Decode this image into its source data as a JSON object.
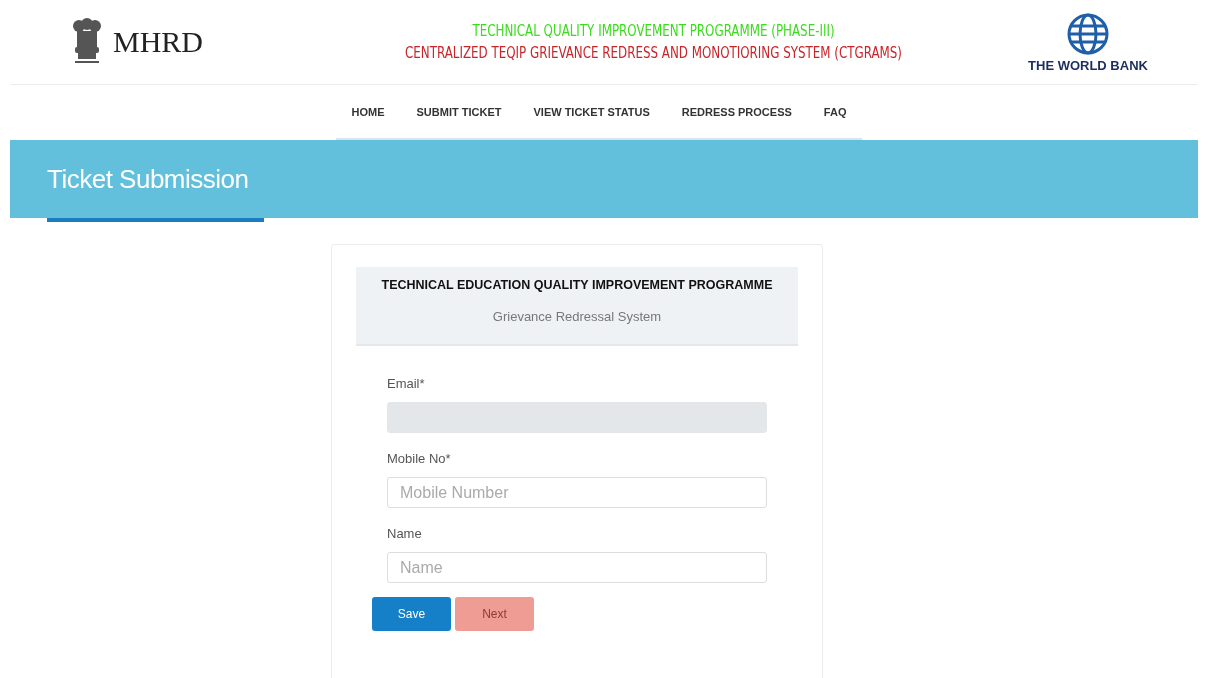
{
  "header": {
    "logo_text": "MHRD",
    "title_line_1": "TECHNICAL QUALITY IMPROVEMENT PROGRAMME (PHASE-III)",
    "title_line_2": "CENTRALIZED TEQIP GRIEVANCE REDRESS AND MONOTIORING SYSTEM (CTGRAMS)",
    "partner_logo_text": "THE WORLD BANK"
  },
  "nav": [
    {
      "label": "HOME"
    },
    {
      "label": "SUBMIT TICKET"
    },
    {
      "label": "VIEW TICKET STATUS"
    },
    {
      "label": "REDRESS PROCESS"
    },
    {
      "label": "FAQ"
    }
  ],
  "banner": {
    "title": "Ticket Submission"
  },
  "form": {
    "heading": "TECHNICAL EDUCATION QUALITY IMPROVEMENT PROGRAMME",
    "subheading": "Grievance Redressal System",
    "fields": [
      {
        "label": "Email*",
        "disabled": true
      },
      {
        "label": "Mobile No*",
        "placeholder": "Mobile Number",
        "disabled": false
      },
      {
        "label": "Name",
        "placeholder": "Name",
        "disabled": false
      }
    ],
    "buttons": [
      {
        "label": "Save",
        "kind": "primary",
        "disabled": false
      },
      {
        "label": "Next",
        "kind": "danger",
        "disabled": true
      }
    ]
  }
}
